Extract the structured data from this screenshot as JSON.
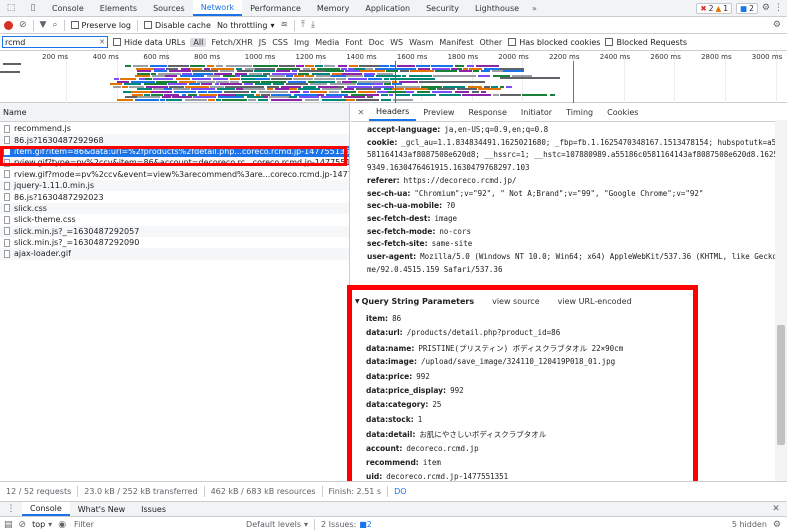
{
  "topbar": {
    "tabs": [
      "Console",
      "Elements",
      "Sources",
      "Network",
      "Performance",
      "Memory",
      "Application",
      "Security",
      "Lighthouse"
    ],
    "active_tab": "Network",
    "errors": "2",
    "warnings": "1",
    "issues": "2"
  },
  "toolbar": {
    "preserve_log": "Preserve log",
    "disable_cache": "Disable cache",
    "throttling": "No throttling"
  },
  "filter": {
    "value": "rcmd",
    "hide_data_urls": "Hide data URLs",
    "types": [
      "All",
      "Fetch/XHR",
      "JS",
      "CSS",
      "Img",
      "Media",
      "Font",
      "Doc",
      "WS",
      "Wasm",
      "Manifest",
      "Other"
    ],
    "has_blocked_cookies": "Has blocked cookies",
    "blocked_requests": "Blocked Requests"
  },
  "overview": {
    "ticks": [
      "200 ms",
      "400 ms",
      "600 ms",
      "800 ms",
      "1000 ms",
      "1200 ms",
      "1400 ms",
      "1600 ms",
      "1800 ms",
      "2000 ms",
      "2200 ms",
      "2400 ms",
      "2600 ms",
      "2800 ms",
      "3000 ms"
    ]
  },
  "requests": {
    "column": "Name",
    "rows": [
      "recommend.js",
      "86.js?1630487292968",
      "item.gif?item=86&data:url=%2fproducts%2fdetail.php...coreco.rcmd.jp-1477551351&timestam...",
      "rview.gif?type=pv%2ccv&item=86&account=decoreco.rc...coreco.rcmd.jp-1477551351&timesta...",
      "rview.gif?mode=pv%2ccv&event=view%3arecommend%3are...coreco.rcmd.jp-1477551351&ti...",
      "jquery-1.11.0.min.js",
      "86.js?1630487292023",
      "slick.css",
      "slick-theme.css",
      "slick.min.js?_=1630487292057",
      "slick.min.js?_=1630487292090",
      "ajax-loader.gif"
    ],
    "selected_index": 2
  },
  "detail": {
    "tabs": [
      "Headers",
      "Preview",
      "Response",
      "Initiator",
      "Timing",
      "Cookies"
    ],
    "active_tab": "Headers",
    "headers": [
      {
        "k": "accept-language:",
        "v": "ja,en-US;q=0.9,en;q=0.8"
      },
      {
        "k": "cookie:",
        "v": "_gcl_au=1.1.834834491.1625021680; _fbp=fb.1.1625470348167.1513478154; hubspotutk=a55186c0"
      },
      {
        "k": "",
        "v": "581164143af8087508e620d8; __hssrc=1; __hstc=107880989.a55186c0581164143af8087508e620d8.1625021677"
      },
      {
        "k": "",
        "v": "9349.1630476461915.1630479768297.103"
      },
      {
        "k": "referer:",
        "v": "https://decoreco.rcmd.jp/"
      },
      {
        "k": "sec-ch-ua:",
        "v": "\"Chromium\";v=\"92\", \" Not A;Brand\";v=\"99\", \"Google Chrome\";v=\"92\""
      },
      {
        "k": "sec-ch-ua-mobile:",
        "v": "?0"
      },
      {
        "k": "sec-fetch-dest:",
        "v": "image"
      },
      {
        "k": "sec-fetch-mode:",
        "v": "no-cors"
      },
      {
        "k": "sec-fetch-site:",
        "v": "same-site"
      },
      {
        "k": "user-agent:",
        "v": "Mozilla/5.0 (Windows NT 10.0; Win64; x64) AppleWebKit/537.36 (KHTML, like Gecko) Chro"
      },
      {
        "k": "",
        "v": "me/92.0.4515.159 Safari/537.36"
      }
    ],
    "qsp": {
      "title": "Query String Parameters",
      "view_source": "view source",
      "view_url_encoded": "view URL-encoded",
      "params": [
        {
          "k": "item:",
          "v": "86"
        },
        {
          "k": "data:url:",
          "v": "/products/detail.php?product_id=86"
        },
        {
          "k": "data:name:",
          "v": "PRISTINE(プリスティン) ボディスクラブタオル 22×90cm"
        },
        {
          "k": "data:image:",
          "v": "/upload/save_image/324110_120419P018_01.jpg"
        },
        {
          "k": "data:price:",
          "v": "992"
        },
        {
          "k": "data:price_display:",
          "v": "992"
        },
        {
          "k": "data:category:",
          "v": "25"
        },
        {
          "k": "data:stock:",
          "v": "1"
        },
        {
          "k": "data:detail:",
          "v": "お肌にやさしいボディスクラブタオル"
        },
        {
          "k": "account:",
          "v": "decoreco.rcmd.jp"
        },
        {
          "k": "recommend:",
          "v": "item"
        },
        {
          "k": "uid:",
          "v": "decoreco.rcmd.jp-1477551351"
        },
        {
          "k": "timestamp:",
          "v": "1630487291959"
        }
      ]
    }
  },
  "status": {
    "requests": "12 / 52 requests",
    "transferred": "23.0 kB / 252 kB transferred",
    "resources": "462 kB / 683 kB resources",
    "finish": "Finish: 2.51 s",
    "dom": "DO"
  },
  "drawer": {
    "tabs": [
      "Console",
      "What's New",
      "Issues"
    ],
    "context": "top",
    "filter_placeholder": "Filter",
    "levels": "Default levels",
    "issues_label": "2 Issues:",
    "issues_count": "2",
    "hidden": "5 hidden"
  }
}
